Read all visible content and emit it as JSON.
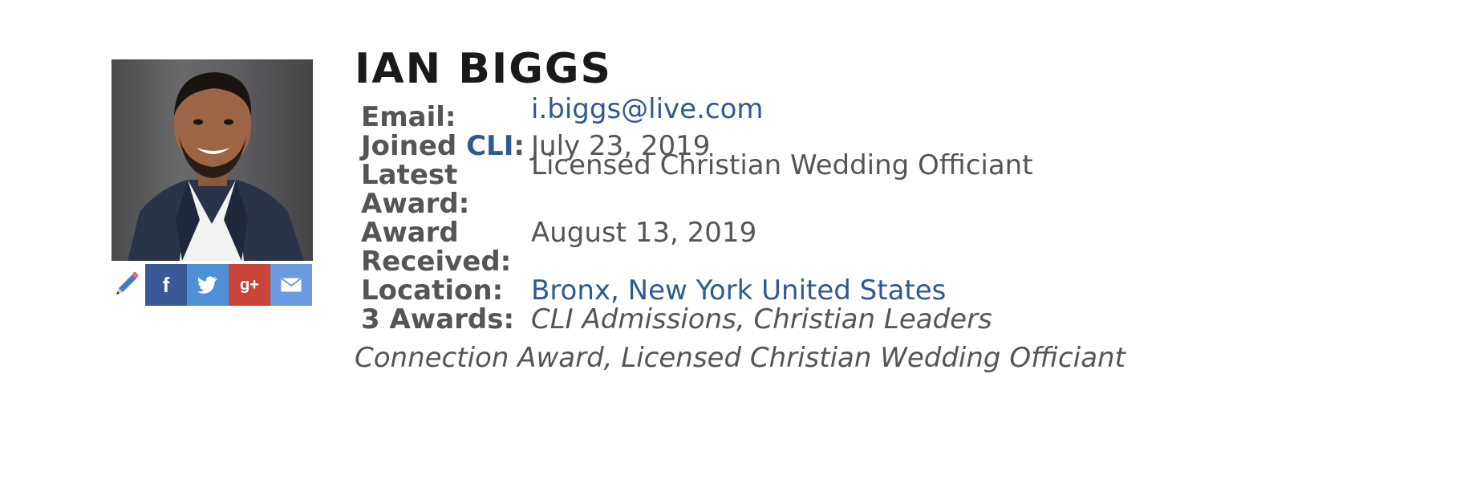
{
  "profile": {
    "name": "IAN BIGGS",
    "photo_icon": "profile-photo"
  },
  "share": {
    "edit_icon": "pencil-icon",
    "facebook_label": "f",
    "googleplus_label": "g+",
    "colors": {
      "facebook": "#3b5998",
      "twitter": "#4f8fd6",
      "googleplus": "#c9453a",
      "email": "#6a9be0"
    }
  },
  "info": {
    "email_label": "Email:",
    "email_value": "i.biggs@live.com",
    "joined_label_prefix": "Joined ",
    "joined_label_link": "CLI",
    "joined_label_suffix": ":",
    "joined_value": "July 23, 2019",
    "latest_award_label_1": "Latest",
    "latest_award_label_2": "Award:",
    "latest_award_value": "Licensed Christian Wedding Officiant",
    "award_received_label_1": "Award",
    "award_received_label_2": "Received:",
    "award_received_value": "August 13, 2019",
    "location_label": "Location:",
    "location_value": "Bronx, New York United States",
    "awards_label": "3 Awards:",
    "awards_value_line1": "CLI Admissions, Christian Leaders",
    "awards_value_line2": "Connection Award, Licensed Christian Wedding Officiant"
  },
  "colors": {
    "link": "#2f5a8e",
    "text": "#555555",
    "heading": "#1a1a1a"
  }
}
